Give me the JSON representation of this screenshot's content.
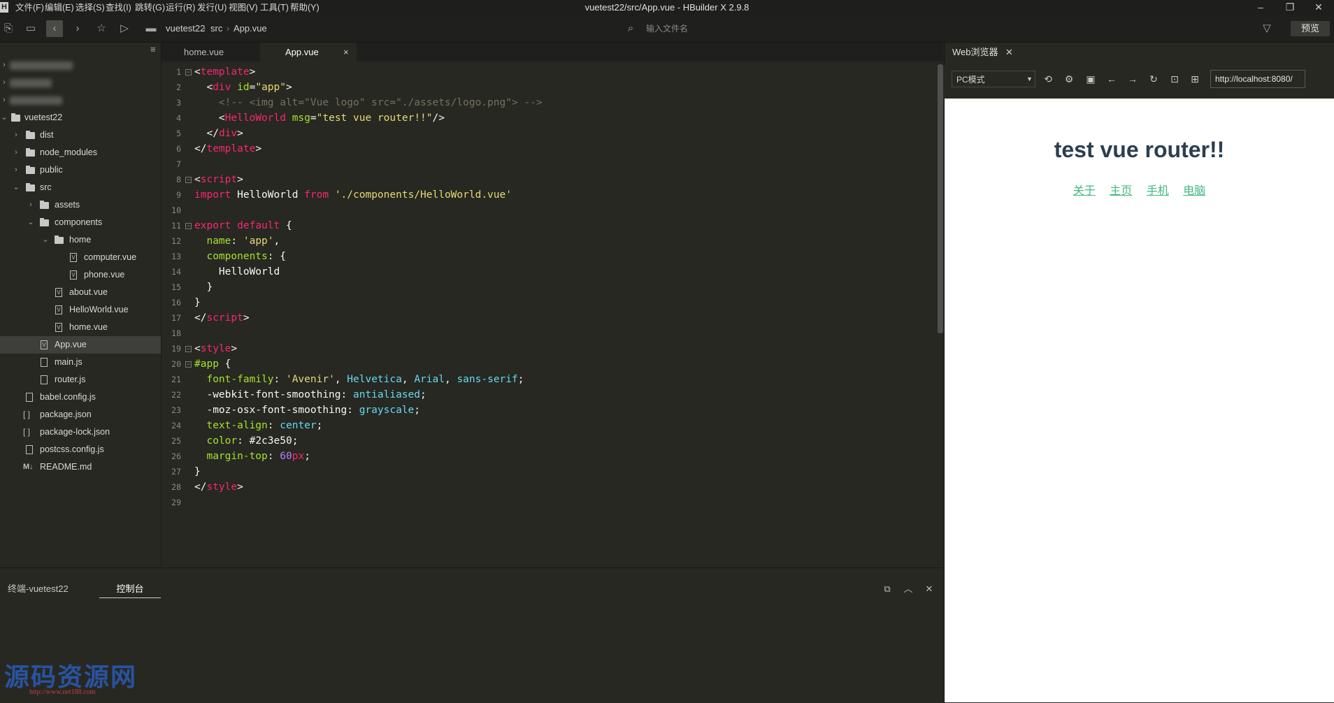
{
  "menubar": {
    "app_icon": "H",
    "items": [
      "文件(F)",
      "编辑(E)",
      "选择(S)",
      "查找(I)",
      "跳转(G)",
      "运行(R)",
      "发行(U)",
      "视图(V)",
      "工具(T)",
      "帮助(Y)"
    ],
    "title": "vuetest22/src/App.vue - HBuilder X 2.9.8"
  },
  "toolbar": {
    "breadcrumb": [
      "vuetest22",
      "src",
      "App.vue"
    ],
    "file_search_placeholder": "输入文件名",
    "preview_label": "预览"
  },
  "sidebar": {
    "root": "vuetest22",
    "items": [
      {
        "label": "dist"
      },
      {
        "label": "node_modules"
      },
      {
        "label": "public"
      },
      {
        "label": "src"
      },
      {
        "label": "assets"
      },
      {
        "label": "components"
      },
      {
        "label": "home"
      },
      {
        "label": "computer.vue"
      },
      {
        "label": "phone.vue"
      },
      {
        "label": "about.vue"
      },
      {
        "label": "HelloWorld.vue"
      },
      {
        "label": "home.vue"
      },
      {
        "label": "App.vue"
      },
      {
        "label": "main.js"
      },
      {
        "label": "router.js"
      },
      {
        "label": "babel.config.js"
      },
      {
        "label": "package.json"
      },
      {
        "label": "package-lock.json"
      },
      {
        "label": "postcss.config.js"
      },
      {
        "label": "README.md"
      }
    ]
  },
  "editor": {
    "tabs": [
      {
        "label": "home.vue"
      },
      {
        "label": "App.vue"
      }
    ],
    "close_glyph": "×",
    "line_numbers": [
      "1",
      "2",
      "3",
      "4",
      "5",
      "6",
      "7",
      "8",
      "9",
      "10",
      "11",
      "12",
      "13",
      "14",
      "15",
      "16",
      "17",
      "18",
      "19",
      "20",
      "21",
      "22",
      "23",
      "24",
      "25",
      "26",
      "27",
      "28",
      "29"
    ]
  },
  "bottom_panel": {
    "tabs": [
      {
        "label": "终端-vuetest22"
      },
      {
        "label": "控制台"
      }
    ]
  },
  "browser": {
    "tab_label": "Web浏览器",
    "mode": "PC模式",
    "url": "http://localhost:8080/",
    "heading": "test vue router!!",
    "nav_links": [
      "关于",
      "主页",
      "手机",
      "电脑"
    ]
  },
  "watermark": {
    "text": "源码资源网",
    "url": "http://www.net188.com"
  }
}
